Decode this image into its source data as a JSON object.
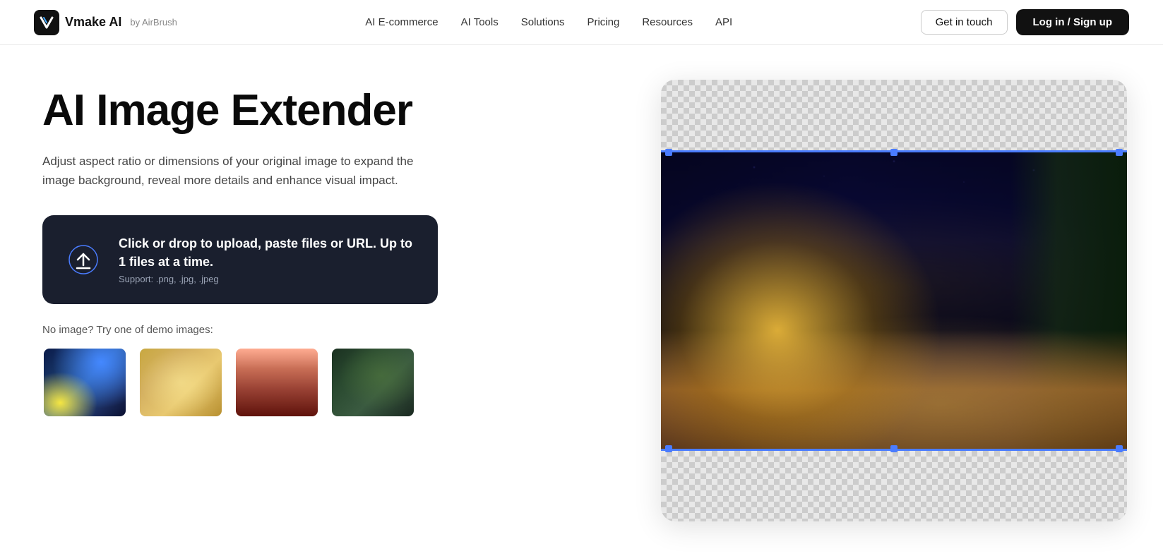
{
  "brand": {
    "name": "Vmake AI",
    "by": "by AirBrush"
  },
  "nav": {
    "links": [
      {
        "label": "AI E-commerce",
        "id": "ai-ecommerce"
      },
      {
        "label": "AI Tools",
        "id": "ai-tools"
      },
      {
        "label": "Solutions",
        "id": "solutions"
      },
      {
        "label": "Pricing",
        "id": "pricing"
      },
      {
        "label": "Resources",
        "id": "resources"
      },
      {
        "label": "API",
        "id": "api"
      }
    ],
    "cta_touch": "Get in touch",
    "cta_signup": "Log in / Sign up"
  },
  "hero": {
    "title": "AI Image Extender",
    "description": "Adjust aspect ratio or dimensions of your original image to expand the image background, reveal more details and enhance visual impact.",
    "upload": {
      "main_text": "Click or drop to upload, paste files or URL. Up to 1 files at a time.",
      "support_text": "Support: .png, .jpg, .jpeg"
    },
    "demo_label": "No image? Try one of demo images:",
    "demo_images": [
      {
        "id": "starry-night",
        "alt": "Starry Night demo"
      },
      {
        "id": "golden-field",
        "alt": "Golden field demo"
      },
      {
        "id": "red-canyon",
        "alt": "Red canyon demo"
      },
      {
        "id": "forest-water",
        "alt": "Forest water demo"
      }
    ]
  },
  "preview": {
    "image_alt": "Cafe Terrace at Night by Van Gogh - extended"
  },
  "colors": {
    "accent": "#4a7cff",
    "dark": "#1a1f2e",
    "button_bg": "#111111"
  }
}
